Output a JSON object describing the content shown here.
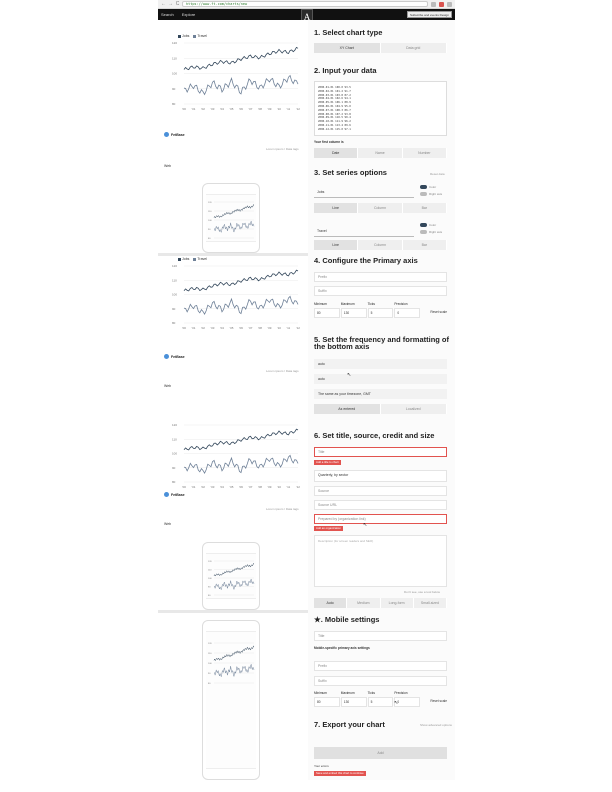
{
  "browser": {
    "url": "https://www.ft.com/charts/new",
    "back": "←",
    "forward": "→",
    "reload": "C"
  },
  "app": {
    "search": "Search",
    "explore": "Explore",
    "logo_letter": "A",
    "right_button": "Subscribe and events Design"
  },
  "chart": {
    "legend": [
      {
        "name": "Jobs",
        "color": "#33475b"
      },
      {
        "name": "Travel",
        "color": "#6f8198"
      }
    ],
    "y_ticks": [
      "120",
      "110",
      "100",
      "90",
      "80"
    ],
    "x_ticks": [
      "'00",
      "'01",
      "'02",
      "'03",
      "'04",
      "'05",
      "'06",
      "'07",
      "'08",
      "'09",
      "'10",
      "'11",
      "'12"
    ],
    "brand": "FetBase",
    "source_link": "Lorem ipsum / Data tags",
    "web_label": "Web"
  },
  "chart_data": {
    "type": "line",
    "x": [
      "2000",
      "2001",
      "2002",
      "2003",
      "2004",
      "2005",
      "2006",
      "2007",
      "2008",
      "2009",
      "2010",
      "2011",
      "2012"
    ],
    "series": [
      {
        "name": "Jobs",
        "values": [
          104,
          106,
          105,
          108,
          110,
          109,
          112,
          114,
          113,
          116,
          118,
          117,
          120
        ]
      },
      {
        "name": "Travel",
        "values": [
          88,
          92,
          86,
          94,
          89,
          95,
          87,
          96,
          90,
          97,
          91,
          98,
          93
        ]
      }
    ],
    "ylim": [
      78,
      124
    ]
  },
  "panel": {
    "s1_title": "1. Select chart type",
    "s1_options": [
      "XY Chart",
      "Data grid"
    ],
    "s2_title": "2. Input your data",
    "data_lines": [
      "2000-01-01    100.0    93.5",
      "2000-02-01    101.2    91.7",
      "2000-03-01    103.8    87.2",
      "2000-04-01    102.6    94.1",
      "2000-05-01    106.1    88.9",
      "2000-06-01    104.9    95.0",
      "2000-07-01    108.3    86.7",
      "2000-08-01    107.2    93.8",
      "2000-09-01    110.5    90.4",
      "2000-10-01    111.9    96.2",
      "2000-11-01    113.4    89.6",
      "2000-12-01    115.0    97.1"
    ],
    "first_column_label": "Your first column is",
    "first_column_options": [
      "Date",
      "Name",
      "Number"
    ],
    "s3_title": "3. Set series options",
    "reset_label": "Reset data",
    "series_opts": [
      {
        "name": "Jobs",
        "toggle1": "Color",
        "toggle2": "Right axis",
        "types": [
          "Line",
          "Column",
          "Bar"
        ]
      },
      {
        "name": "Travel",
        "toggle1": "Color",
        "toggle2": "Right axis",
        "types": [
          "Line",
          "Column",
          "Bar"
        ]
      }
    ],
    "s4_title": "4. Configure the Primary axis",
    "prefix_ph": "Prefix",
    "suffix_ph": "Suffix",
    "axis_headers": [
      "Minimum",
      "Maximum",
      "Ticks",
      "Precision",
      ""
    ],
    "axis_values": [
      "80",
      "130",
      "5",
      "0",
      "Reset scale"
    ],
    "s5_title": "5. Set the frequency and formatting of the bottom axis",
    "auto1": "auto",
    "auto2": "auto",
    "timezone_note": "The same as your timezone, GMT",
    "s5_options": [
      "As entered",
      "Localized"
    ],
    "s6_title": "6. Set title, source, credit and size",
    "title_ph": "Title",
    "title_err": "Add a title to chart",
    "subtitle_label": "Subt...",
    "subtitle_val": "Quarterly, by sector",
    "source_ph": "Source",
    "source_url_ph": "Source URL",
    "credit_ph": "Prepared by (organization link)",
    "credit_err": "Add an organization",
    "textarea_ph": "Description (for screen readers and SEO)",
    "chars_note": "Don't see, use a tool below",
    "size_options": [
      "Auto",
      "Medium",
      "Long-form",
      "Small-sized"
    ],
    "s_mobile_title": "★. Mobile settings",
    "mobile_title_ph": "Title",
    "mobile_axis_label": "Mobile-specific primary axis settings",
    "s7_title": "7. Export your chart",
    "export_note": "Show advanced options",
    "export_btn": "Add",
    "export_label": "Your errors",
    "export_err": "Save and embed this chart to continue"
  }
}
